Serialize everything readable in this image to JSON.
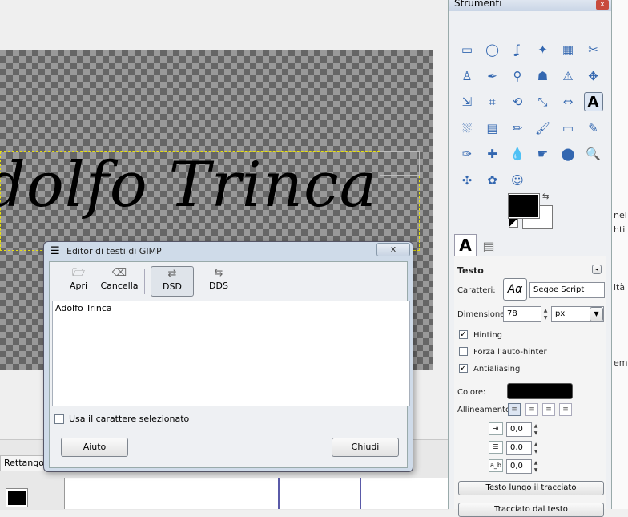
{
  "canvas": {
    "text": "dolfo Trinca"
  },
  "bottom": {
    "tab_label": "Rettango"
  },
  "right_edge": {
    "fragments": [
      "nel",
      "hti",
      "ltà",
      "em"
    ]
  },
  "toolbox": {
    "title": "Strumenti",
    "close": "x",
    "tools": [
      {
        "name": "rect-select-icon",
        "glyph": "▭"
      },
      {
        "name": "ellipse-select-icon",
        "glyph": "◯"
      },
      {
        "name": "free-select-icon",
        "glyph": "ʆ"
      },
      {
        "name": "fuzzy-select-icon",
        "glyph": "✦"
      },
      {
        "name": "color-select-icon",
        "glyph": "▦"
      },
      {
        "name": "scissors-icon",
        "glyph": "✂"
      },
      {
        "name": "foreground-select-icon",
        "glyph": "♙"
      },
      {
        "name": "paths-icon",
        "glyph": "✒"
      },
      {
        "name": "color-picker-icon",
        "glyph": "⚲"
      },
      {
        "name": "clone-stamp-icon",
        "glyph": "☗"
      },
      {
        "name": "measure-icon",
        "glyph": "⚠"
      },
      {
        "name": "move-icon",
        "glyph": "✥"
      },
      {
        "name": "align-icon",
        "glyph": "⇲"
      },
      {
        "name": "crop-icon",
        "glyph": "⌗"
      },
      {
        "name": "rotate-icon",
        "glyph": "⟲"
      },
      {
        "name": "scale-icon",
        "glyph": "⤡"
      },
      {
        "name": "shear-icon",
        "glyph": "⇔"
      },
      {
        "name": "text-tool-icon",
        "glyph": "A"
      },
      {
        "name": "bucket-fill-icon",
        "glyph": "⛆"
      },
      {
        "name": "blend-icon",
        "glyph": "▤"
      },
      {
        "name": "pencil-icon",
        "glyph": "✏"
      },
      {
        "name": "paintbrush-icon",
        "glyph": "🖌"
      },
      {
        "name": "eraser-icon",
        "glyph": "▭"
      },
      {
        "name": "airbrush-icon",
        "glyph": "✎"
      },
      {
        "name": "ink-icon",
        "glyph": "✑"
      },
      {
        "name": "heal-icon",
        "glyph": "✚"
      },
      {
        "name": "smudge-drop-icon",
        "glyph": "💧"
      },
      {
        "name": "dodge-icon",
        "glyph": "☛"
      },
      {
        "name": "burn-icon",
        "glyph": "⬤"
      },
      {
        "name": "zoom-icon",
        "glyph": "🔍"
      },
      {
        "name": "transform-icon",
        "glyph": "✣"
      },
      {
        "name": "cage-icon",
        "glyph": "✿"
      },
      {
        "name": "gimp-wilber-icon",
        "glyph": "☺"
      }
    ],
    "tab_text": "A",
    "options": {
      "section_title": "Testo",
      "font_label": "Caratteri:",
      "font_preview": "Aα",
      "font_value": "Segoe Script",
      "size_label": "Dimensione:",
      "size_value": "78",
      "unit_value": "px",
      "hinting_label": "Hinting",
      "hinting_checked": "✓",
      "autohint_label": "Forza l'auto-hinter",
      "antialias_label": "Antialiasing",
      "antialias_checked": "✓",
      "color_label": "Colore:",
      "color_value": "#000000",
      "align_label": "Allineamento:",
      "indent_value": "0,0",
      "line_spacing_value": "0,0",
      "letter_spacing_value": "0,0",
      "letter_icon": "a_b",
      "path_button": "Testo lungo il tracciato",
      "outline_button": "Tracciato dal testo"
    }
  },
  "dialog": {
    "title": "Editor di testi di GIMP",
    "close_label": "x",
    "toolbar": [
      {
        "label": "Apri",
        "icon": "🗁",
        "name": "open"
      },
      {
        "label": "Cancella",
        "icon": "⌫",
        "name": "clear"
      },
      {
        "label": "DSD",
        "icon": "⇄",
        "name": "dsd"
      },
      {
        "label": "DDS",
        "icon": "⇆",
        "name": "dds"
      }
    ],
    "text_content": "Adolfo Trinca",
    "use_font_label": "Usa il carattere selezionato",
    "help_button": "Aiuto",
    "close_button": "Chiudi"
  }
}
